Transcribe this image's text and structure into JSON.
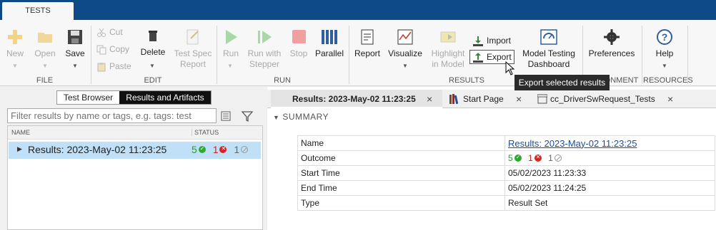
{
  "app": {
    "tab": "TESTS"
  },
  "ribbon": {
    "file": {
      "label": "FILE",
      "new": "New",
      "open": "Open",
      "save": "Save"
    },
    "edit": {
      "label": "EDIT",
      "cut": "Cut",
      "copy": "Copy",
      "paste": "Paste",
      "delete": "Delete",
      "test_spec_1": "Test Spec",
      "test_spec_2": "Report"
    },
    "run": {
      "label": "RUN",
      "run": "Run",
      "run_with_1": "Run with",
      "run_with_2": "Stepper",
      "stop": "Stop",
      "parallel": "Parallel"
    },
    "results": {
      "label": "RESULTS",
      "report": "Report",
      "visualize": "Visualize",
      "highlight_1": "Highlight",
      "highlight_2": "in Model",
      "import": "Import",
      "export": "Export",
      "dashboard_1": "Model Testing",
      "dashboard_2": "Dashboard"
    },
    "environment": {
      "label": "ONMENT",
      "preferences": "Preferences"
    },
    "resources": {
      "label": "RESOURCES",
      "help": "Help"
    }
  },
  "tooltip": "Export selected results",
  "left": {
    "toggle": [
      "Test Browser",
      "Results and Artifacts"
    ],
    "filter_placeholder": "Filter results by name or tags, e.g. tags: test",
    "col_name": "NAME",
    "col_status": "STATUS",
    "row": {
      "name": "Results: 2023-May-02 11:23:25",
      "passed": "5",
      "failed": "1",
      "skipped": "1"
    }
  },
  "tabs": [
    {
      "label": "Results: 2023-May-02 11:23:25"
    },
    {
      "label": "Start Page"
    },
    {
      "label": "cc_DriverSwRequest_Tests"
    }
  ],
  "summary": {
    "header": "SUMMARY",
    "rows": [
      {
        "key": "Name",
        "value": "Results: 2023-May-02 11:23:25"
      },
      {
        "key": "Outcome",
        "passed": "5",
        "failed": "1",
        "skipped": "1"
      },
      {
        "key": "Start Time",
        "value": "05/02/2023 11:23:33"
      },
      {
        "key": "End Time",
        "value": "05/02/2023 11:24:25"
      },
      {
        "key": "Type",
        "value": "Result Set"
      }
    ]
  },
  "colors": {
    "title_bar": "#0e4a86",
    "selection": "#bfe0f7",
    "pass": "#2faa2f",
    "fail": "#d92323"
  }
}
